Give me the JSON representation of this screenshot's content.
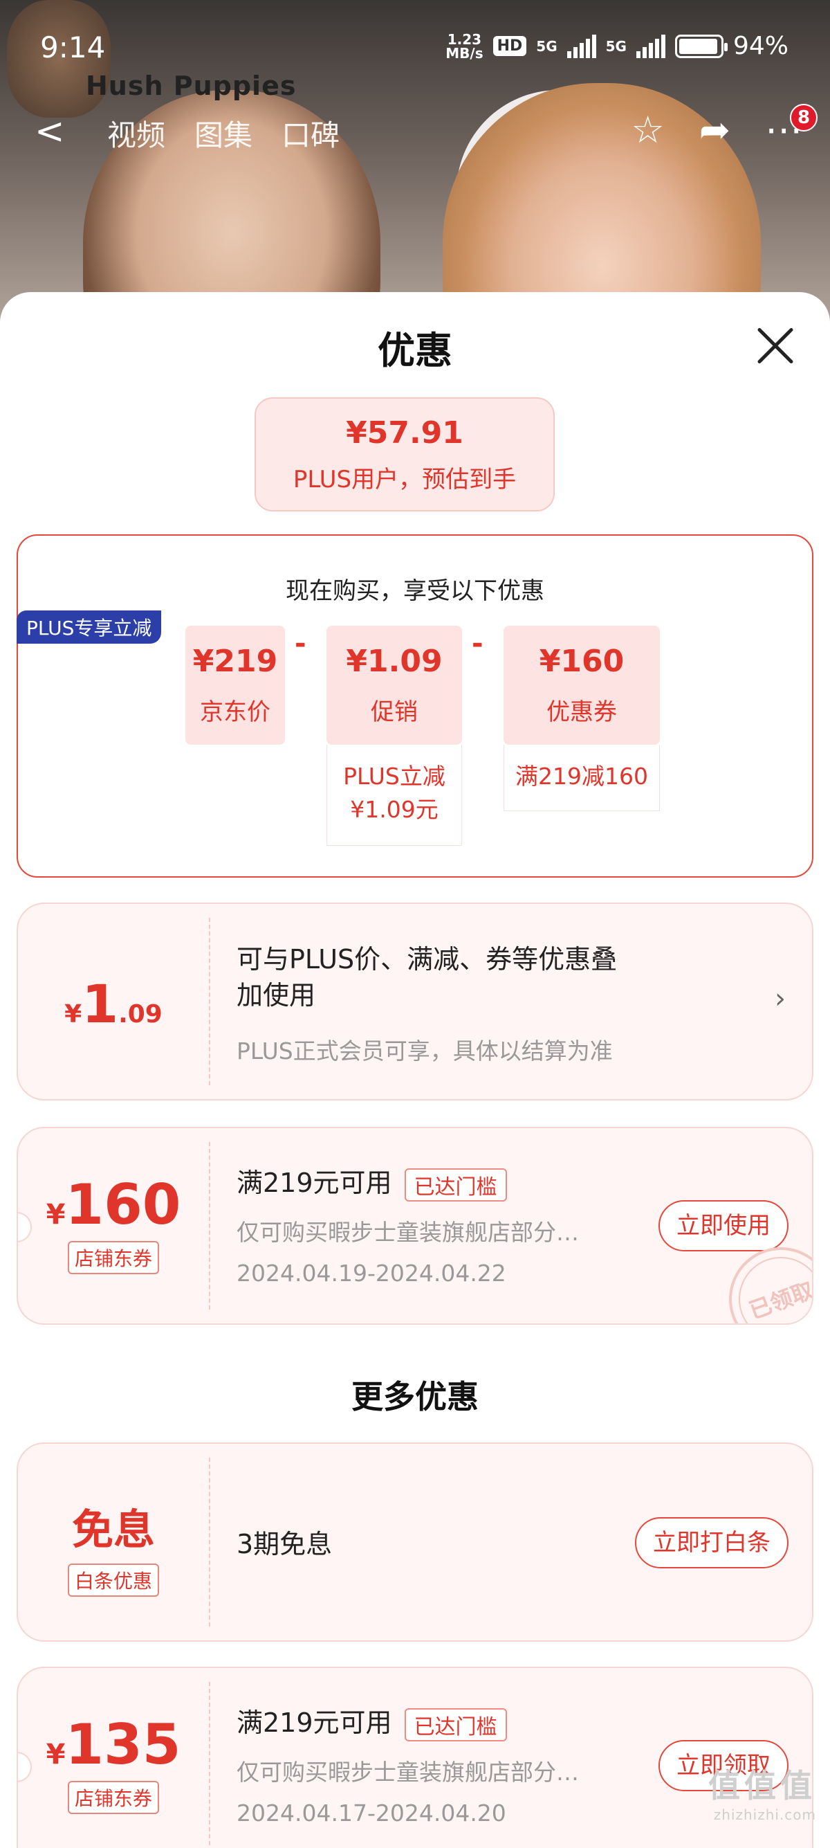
{
  "status_bar": {
    "time": "9:14",
    "net_speed_value": "1.23",
    "net_speed_unit": "MB/s",
    "hd": "HD",
    "sim1": "5G",
    "sim2": "5G",
    "battery": "94%",
    "battery_level": 0.94
  },
  "nav": {
    "brand_logo_text": "Hush Puppies",
    "back": "<",
    "tabs": [
      "视频",
      "图集",
      "口碑"
    ],
    "badge_count": "8"
  },
  "sheet": {
    "title": "优惠",
    "estimate": {
      "price": "¥57.91",
      "label": "PLUS用户，预估到手"
    },
    "calc": {
      "heading": "现在购买，享受以下优惠",
      "minus": "-",
      "items": [
        {
          "value": "¥219",
          "label": "京东价"
        },
        {
          "value": "¥1.09",
          "label": "促销",
          "sub": [
            "PLUS立减",
            "¥1.09元"
          ]
        },
        {
          "value": "¥160",
          "label": "优惠券",
          "sub": [
            "满219减160"
          ]
        }
      ]
    },
    "plus_card": {
      "tag": "PLUS专享立减",
      "currency": "¥",
      "amount_int": "1",
      "amount_dec": ".09",
      "title_line1": "可与PLUS价、满减、券等优惠叠",
      "title_line2": "加使用",
      "note": "PLUS正式会员可享，具体以结算为准",
      "chevron": "›"
    },
    "coupon_1": {
      "currency": "¥",
      "amount": "160",
      "tag": "店铺东券",
      "title": "满219元可用",
      "reached": "已达门槛",
      "desc": "仅可购买暇步士童装旗舰店部分…",
      "dates": "2024.04.19-2024.04.22",
      "button": "立即使用",
      "stamp": "已领取"
    },
    "more_title": "更多优惠",
    "baitiao_card": {
      "amount": "免息",
      "tag": "白条优惠",
      "title": "3期免息",
      "button": "立即打白条"
    },
    "coupon_2": {
      "currency": "¥",
      "amount": "135",
      "tag": "店铺东券",
      "title": "满219元可用",
      "reached": "已达门槛",
      "desc": "仅可购买暇步士童装旗舰店部分…",
      "dates": "2024.04.17-2024.04.20",
      "button": "立即领取"
    }
  },
  "watermark": {
    "main": "值值值",
    "site": "zhizhizhi.com"
  },
  "colors": {
    "accent": "#e0352b",
    "card_bg": "#fff5f4",
    "plus_blue": "#2c3fa8"
  }
}
